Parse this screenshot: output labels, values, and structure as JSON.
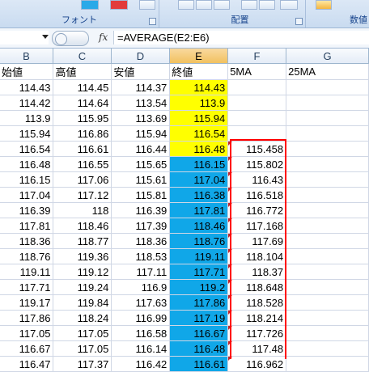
{
  "ribbon": {
    "groups": [
      {
        "label": "フォント"
      },
      {
        "label": "配置"
      },
      {
        "label": "数値"
      }
    ]
  },
  "formula_bar": {
    "name_box": "",
    "fx_label": "fx",
    "formula": "=AVERAGE(E2:E6)"
  },
  "columns": [
    "B",
    "C",
    "D",
    "E",
    "F",
    "G"
  ],
  "selected_column": "E",
  "headers": [
    "始値",
    "高値",
    "安値",
    "終値",
    "5MA",
    "25MA"
  ],
  "rows": [
    [
      "114.43",
      "114.45",
      "114.37",
      "114.43",
      "",
      ""
    ],
    [
      "114.42",
      "114.64",
      "113.54",
      "113.9",
      "",
      ""
    ],
    [
      "113.9",
      "115.95",
      "113.69",
      "115.94",
      "",
      ""
    ],
    [
      "115.94",
      "116.86",
      "115.94",
      "116.54",
      "",
      ""
    ],
    [
      "116.54",
      "116.61",
      "116.44",
      "116.48",
      "115.458",
      ""
    ],
    [
      "116.48",
      "116.55",
      "115.65",
      "116.15",
      "115.802",
      ""
    ],
    [
      "116.15",
      "117.06",
      "115.61",
      "117.04",
      "116.43",
      ""
    ],
    [
      "117.04",
      "117.12",
      "115.81",
      "116.38",
      "116.518",
      ""
    ],
    [
      "116.39",
      "118",
      "116.39",
      "117.81",
      "116.772",
      ""
    ],
    [
      "117.81",
      "118.46",
      "117.39",
      "118.46",
      "117.168",
      ""
    ],
    [
      "118.36",
      "118.77",
      "118.36",
      "118.76",
      "117.69",
      ""
    ],
    [
      "118.76",
      "119.36",
      "118.53",
      "119.11",
      "118.104",
      ""
    ],
    [
      "119.11",
      "119.12",
      "117.11",
      "117.71",
      "118.37",
      ""
    ],
    [
      "117.71",
      "119.24",
      "116.9",
      "119.2",
      "118.648",
      ""
    ],
    [
      "119.17",
      "119.84",
      "117.63",
      "117.86",
      "118.528",
      ""
    ],
    [
      "117.86",
      "118.24",
      "116.99",
      "117.19",
      "118.214",
      ""
    ],
    [
      "117.05",
      "117.05",
      "116.58",
      "116.67",
      "117.726",
      ""
    ],
    [
      "116.67",
      "117.05",
      "116.14",
      "116.48",
      "117.48",
      ""
    ],
    [
      "116.47",
      "117.37",
      "116.42",
      "116.61",
      "116.962",
      ""
    ]
  ],
  "colors": {
    "highlight_yellow": "#ffff00",
    "highlight_blue": "#10a7e8",
    "selection_border": "#ff0000"
  }
}
